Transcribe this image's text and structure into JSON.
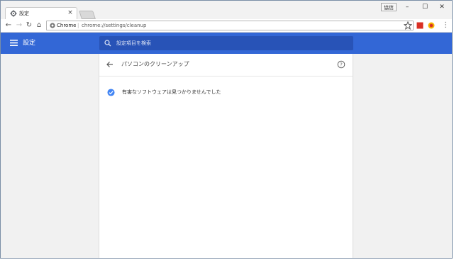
{
  "browser": {
    "tab_title": "設定",
    "tab_close": "×",
    "profile_label": "協信",
    "window_controls": {
      "minimize": "–",
      "maximize": "☐",
      "close": "✕"
    }
  },
  "toolbar": {
    "back": "←",
    "forward": "→",
    "reload": "↻",
    "home": "⌂",
    "site_label": "Chrome",
    "separator": "|",
    "url": "chrome://settings/cleanup",
    "menu": "⋮"
  },
  "settings": {
    "header_title": "設定",
    "search_placeholder": "設定項目を検索"
  },
  "page": {
    "title": "パソコンのクリーンアップ",
    "status_text": "有害なソフトウェアは見つかりませんでした"
  },
  "colors": {
    "header_blue": "#3367d6",
    "search_blue": "#2853b7",
    "check_blue": "#4285f4"
  }
}
